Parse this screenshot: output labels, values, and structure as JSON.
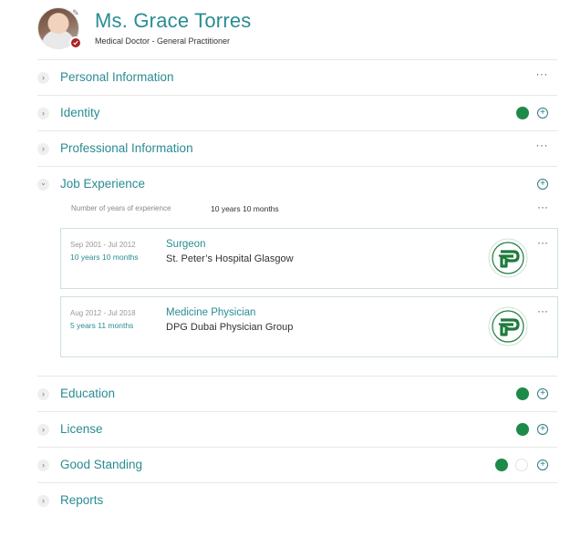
{
  "profile": {
    "name": "Ms. Grace Torres",
    "title": "Medical Doctor - General Practitioner"
  },
  "sections": {
    "personal": {
      "label": "Personal Information"
    },
    "identity": {
      "label": "Identity"
    },
    "professional": {
      "label": "Professional Information"
    },
    "job_experience": {
      "label": "Job Experience",
      "years_label": "Number of years of experience",
      "years_value": "10 years 10 months",
      "entries": [
        {
          "dates": "Sep 2001 - Jul 2012",
          "duration": "10 years 10 months",
          "role": "Surgeon",
          "organization": "St. Peter’s Hospital Glasgow"
        },
        {
          "dates": "Aug 2012 - Jul 2018",
          "duration": "5 years 11 months",
          "role": "Medicine Physician",
          "organization": "DPG Dubai Physician Group"
        }
      ]
    },
    "education": {
      "label": "Education"
    },
    "license": {
      "label": "License"
    },
    "good_standing": {
      "label": "Good Standing"
    },
    "reports": {
      "label": "Reports"
    }
  },
  "icons": {
    "more": "···",
    "add": "+",
    "chevron_right": "›",
    "chevron_down": "⌄"
  },
  "colors": {
    "accent": "#2a8c92",
    "status_green": "#1e8a4a",
    "verified_red": "#a82626",
    "logo_green": "#1f7a3c"
  }
}
